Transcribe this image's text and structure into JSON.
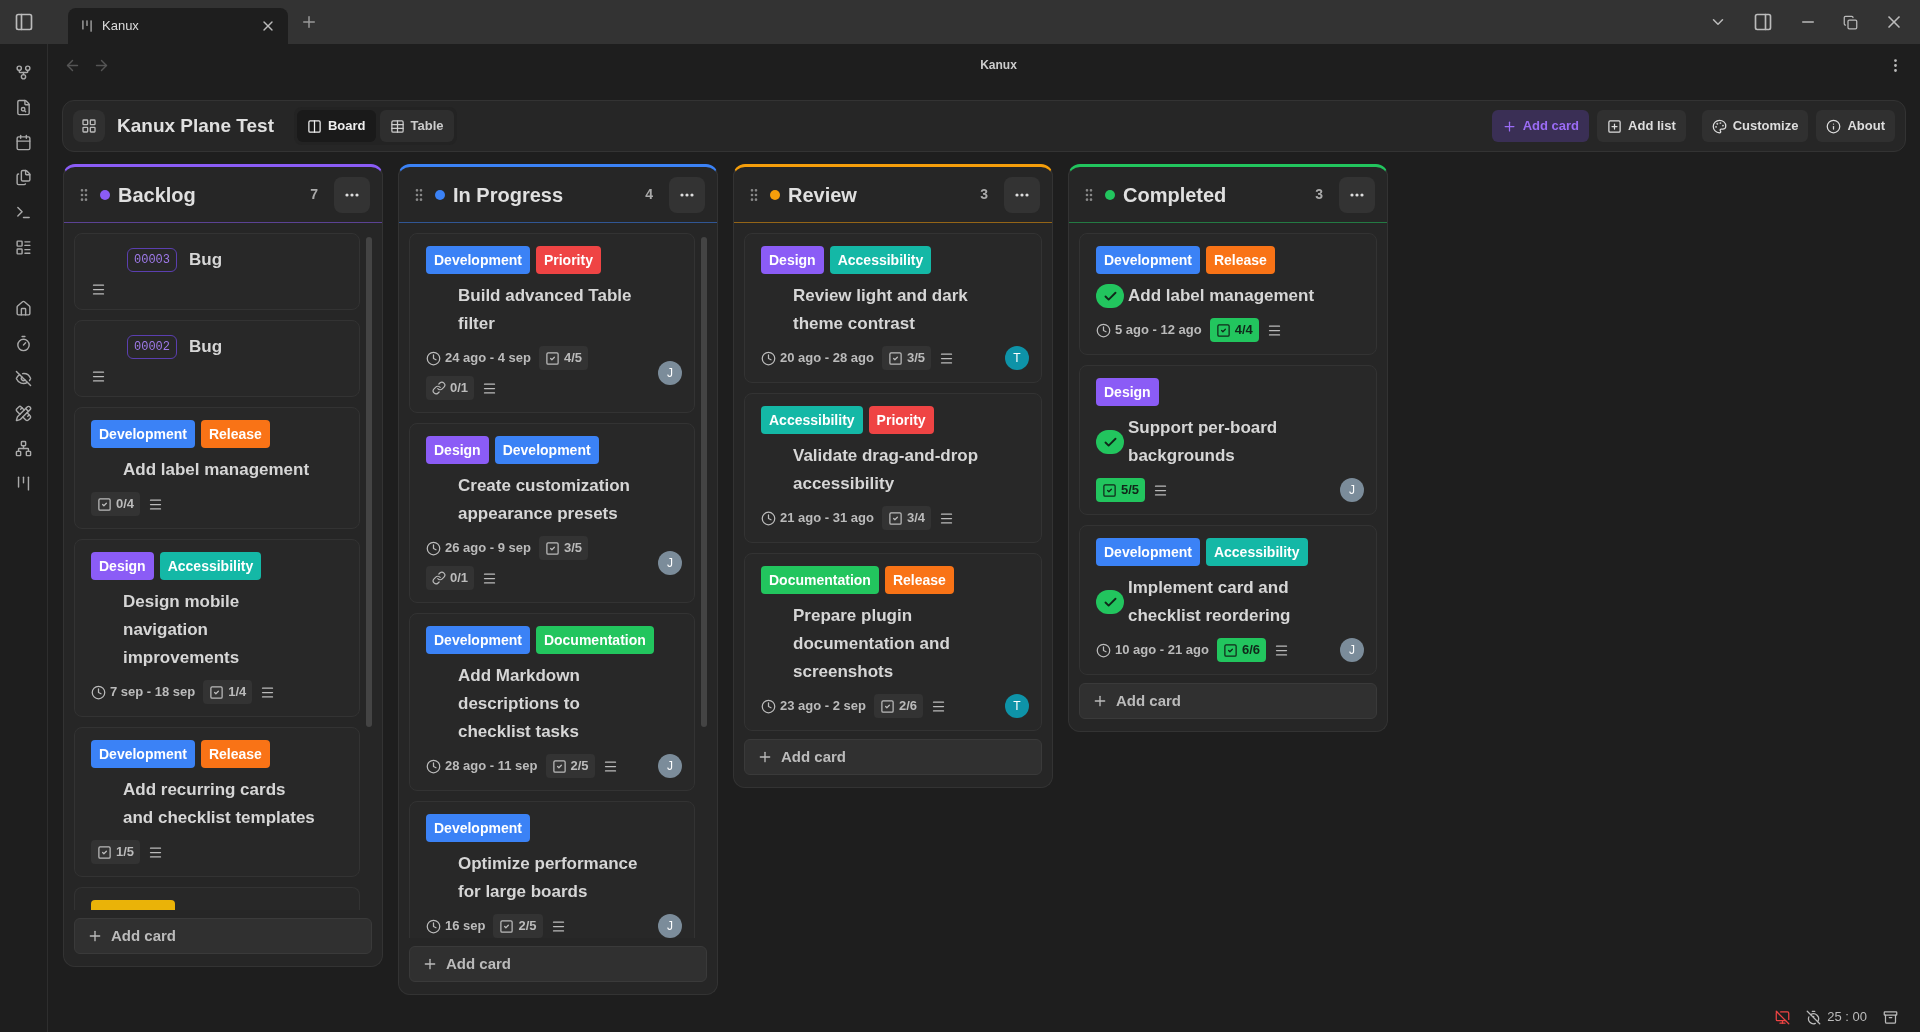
{
  "window": {
    "tab_title": "Kanux",
    "page_title": "Kanux"
  },
  "board": {
    "title": "Kanux Plane Test",
    "view_tabs": [
      {
        "label": "Board",
        "selected": true
      },
      {
        "label": "Table",
        "selected": false
      }
    ],
    "actions": [
      {
        "kind": "add_card",
        "label": "Add card"
      },
      {
        "kind": "add_list",
        "label": "Add list"
      },
      {
        "kind": "customize",
        "label": "Customize"
      },
      {
        "kind": "about",
        "label": "About"
      }
    ]
  },
  "columns": [
    {
      "name": "Backlog",
      "color": "#8b5cf6",
      "count": "7",
      "add_label": "Add card",
      "cards": [
        {
          "id": "00003",
          "title": "Bug",
          "done": false
        },
        {
          "id": "00002",
          "title": "Bug",
          "done": false
        },
        {
          "labels": [
            {
              "text": "Development",
              "color": "#3b82f6"
            },
            {
              "text": "Release",
              "color": "#f97316"
            }
          ],
          "title": "Add label management",
          "done": false,
          "checklist": {
            "text": "0/4",
            "complete": false
          }
        },
        {
          "labels": [
            {
              "text": "Design",
              "color": "#8b5cf6"
            },
            {
              "text": "Accessibility",
              "color": "#14b8a6"
            }
          ],
          "title": "Design mobile navigation improvements",
          "done": false,
          "dates": "7 sep - 18 sep",
          "checklist": {
            "text": "1/4",
            "complete": false
          }
        },
        {
          "labels": [
            {
              "text": "Development",
              "color": "#3b82f6"
            },
            {
              "text": "Release",
              "color": "#f97316"
            }
          ],
          "title": "Add recurring cards and checklist templates",
          "done": false,
          "checklist": {
            "text": "1/5",
            "complete": false
          }
        },
        {
          "cut": true,
          "labels": [
            {
              "color": "#eab308"
            }
          ]
        }
      ]
    },
    {
      "name": "In Progress",
      "color": "#3b82f6",
      "count": "4",
      "add_label": "Add card",
      "cards": [
        {
          "labels": [
            {
              "text": "Development",
              "color": "#3b82f6"
            },
            {
              "text": "Priority",
              "color": "#ef4444"
            }
          ],
          "title": "Build advanced Table filter",
          "done": false,
          "dates": "24 ago - 4 sep",
          "checklist": {
            "text": "4/5",
            "complete": false
          },
          "links": "0/1",
          "avatar": {
            "letter": "J",
            "color": "#7b8c9a"
          }
        },
        {
          "labels": [
            {
              "text": "Design",
              "color": "#8b5cf6"
            },
            {
              "text": "Development",
              "color": "#3b82f6"
            }
          ],
          "title": "Create customization appearance presets",
          "done": false,
          "dates": "26 ago - 9 sep",
          "checklist": {
            "text": "3/5",
            "complete": false
          },
          "links": "0/1",
          "avatar": {
            "letter": "J",
            "color": "#7b8c9a"
          }
        },
        {
          "labels": [
            {
              "text": "Development",
              "color": "#3b82f6"
            },
            {
              "text": "Documentation",
              "color": "#22c55e"
            }
          ],
          "title": "Add Markdown descriptions to checklist tasks",
          "done": false,
          "dates": "28 ago - 11 sep",
          "checklist": {
            "text": "2/5",
            "complete": false
          },
          "avatar": {
            "letter": "J",
            "color": "#7b8c9a"
          }
        },
        {
          "labels": [
            {
              "text": "Development",
              "color": "#3b82f6"
            }
          ],
          "title": "Optimize performance for large boards",
          "done": false,
          "dates": "16 sep",
          "checklist": {
            "text": "2/5",
            "complete": false
          },
          "avatar": {
            "letter": "J",
            "color": "#7b8c9a"
          }
        }
      ]
    },
    {
      "name": "Review",
      "color": "#f59e0b",
      "count": "3",
      "add_label": "Add card",
      "cards": [
        {
          "labels": [
            {
              "text": "Design",
              "color": "#8b5cf6"
            },
            {
              "text": "Accessibility",
              "color": "#14b8a6"
            }
          ],
          "title": "Review light and dark theme contrast",
          "done": false,
          "dates": "20 ago - 28 ago",
          "checklist": {
            "text": "3/5",
            "complete": false
          },
          "avatar": {
            "letter": "T",
            "color": "#0e93a8"
          }
        },
        {
          "labels": [
            {
              "text": "Accessibility",
              "color": "#14b8a6"
            },
            {
              "text": "Priority",
              "color": "#ef4444"
            }
          ],
          "title": "Validate drag-and-drop accessibility",
          "done": false,
          "dates": "21 ago - 31 ago",
          "checklist": {
            "text": "3/4",
            "complete": false
          }
        },
        {
          "labels": [
            {
              "text": "Documentation",
              "color": "#22c55e"
            },
            {
              "text": "Release",
              "color": "#f97316"
            }
          ],
          "title": "Prepare plugin documentation and screenshots",
          "done": false,
          "dates": "23 ago - 2 sep",
          "checklist": {
            "text": "2/6",
            "complete": false
          },
          "avatar": {
            "letter": "T",
            "color": "#0e93a8"
          }
        }
      ]
    },
    {
      "name": "Completed",
      "color": "#22c55e",
      "count": "3",
      "add_label": "Add card",
      "cards": [
        {
          "labels": [
            {
              "text": "Development",
              "color": "#3b82f6"
            },
            {
              "text": "Release",
              "color": "#f97316"
            }
          ],
          "title": "Add label management",
          "done": true,
          "dates": "5 ago - 12 ago",
          "checklist": {
            "text": "4/4",
            "complete": true
          }
        },
        {
          "labels": [
            {
              "text": "Design",
              "color": "#8b5cf6"
            }
          ],
          "title": "Support per-board backgrounds",
          "done": true,
          "checklist": {
            "text": "5/5",
            "complete": true
          },
          "avatar": {
            "letter": "J",
            "color": "#7b8c9a"
          }
        },
        {
          "labels": [
            {
              "text": "Development",
              "color": "#3b82f6"
            },
            {
              "text": "Accessibility",
              "color": "#14b8a6"
            }
          ],
          "title": "Implement card and checklist reordering",
          "done": true,
          "dates": "10 ago - 21 ago",
          "checklist": {
            "text": "6/6",
            "complete": true
          },
          "avatar": {
            "letter": "J",
            "color": "#7b8c9a"
          }
        }
      ]
    }
  ],
  "status_bar": {
    "timer": "25 : 00"
  }
}
